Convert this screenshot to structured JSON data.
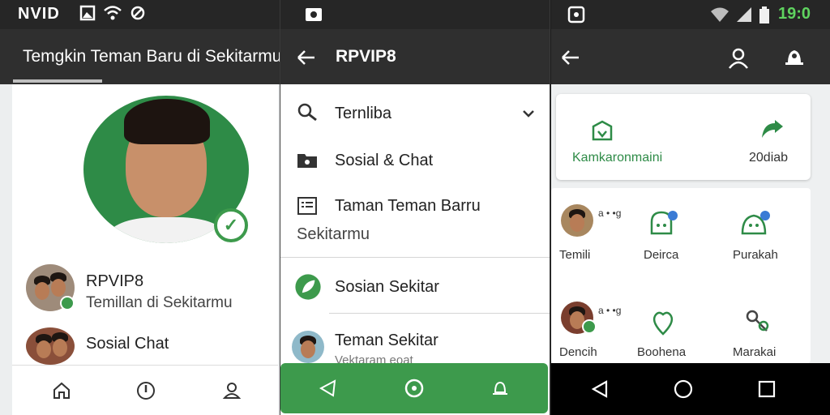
{
  "panel1": {
    "status_text": "NVID",
    "status_icons": [
      "photo-icon",
      "wifi-icon",
      "sync-icon"
    ],
    "title": "Temgkin Teman Baru di Sekitarmu",
    "rows": [
      {
        "title": "RPVIP8",
        "subtitle": "Temillan di Sekitarmu"
      },
      {
        "title": "Sosial Chat",
        "subtitle": ""
      }
    ],
    "bottom_nav": [
      "home-icon",
      "compass-icon",
      "profile-icon"
    ]
  },
  "panel2": {
    "title": "RPVIP8",
    "menu": [
      {
        "label": "Ternliba",
        "icon": "search-icon",
        "has_chevron": true
      },
      {
        "label": "Sosial & Chat",
        "icon": "folder-icon"
      },
      {
        "label": "Taman Teman Barru",
        "icon": "list-icon",
        "sub": "Sekitarmu"
      },
      {
        "label": "Sosian Sekitar",
        "icon": "leaf-icon"
      },
      {
        "label": "Teman Sekitar",
        "sub": "Vektaram eoat"
      }
    ],
    "bottom_nav": [
      "navigate-icon",
      "shield-icon",
      "notify-icon"
    ],
    "accent": "#3d9a4c"
  },
  "panel3": {
    "time": "19:0",
    "top_card": {
      "left_label": "Kamkaronmaini",
      "right_label": "20diab"
    },
    "grid": [
      {
        "label": "Temili",
        "avatar_text": "a • •g"
      },
      {
        "label": "Deirca"
      },
      {
        "label": "Purakah"
      },
      {
        "label": "Dencih",
        "avatar_text": "a • •g"
      },
      {
        "label": "Boohena"
      },
      {
        "label": "Marakai"
      }
    ]
  }
}
